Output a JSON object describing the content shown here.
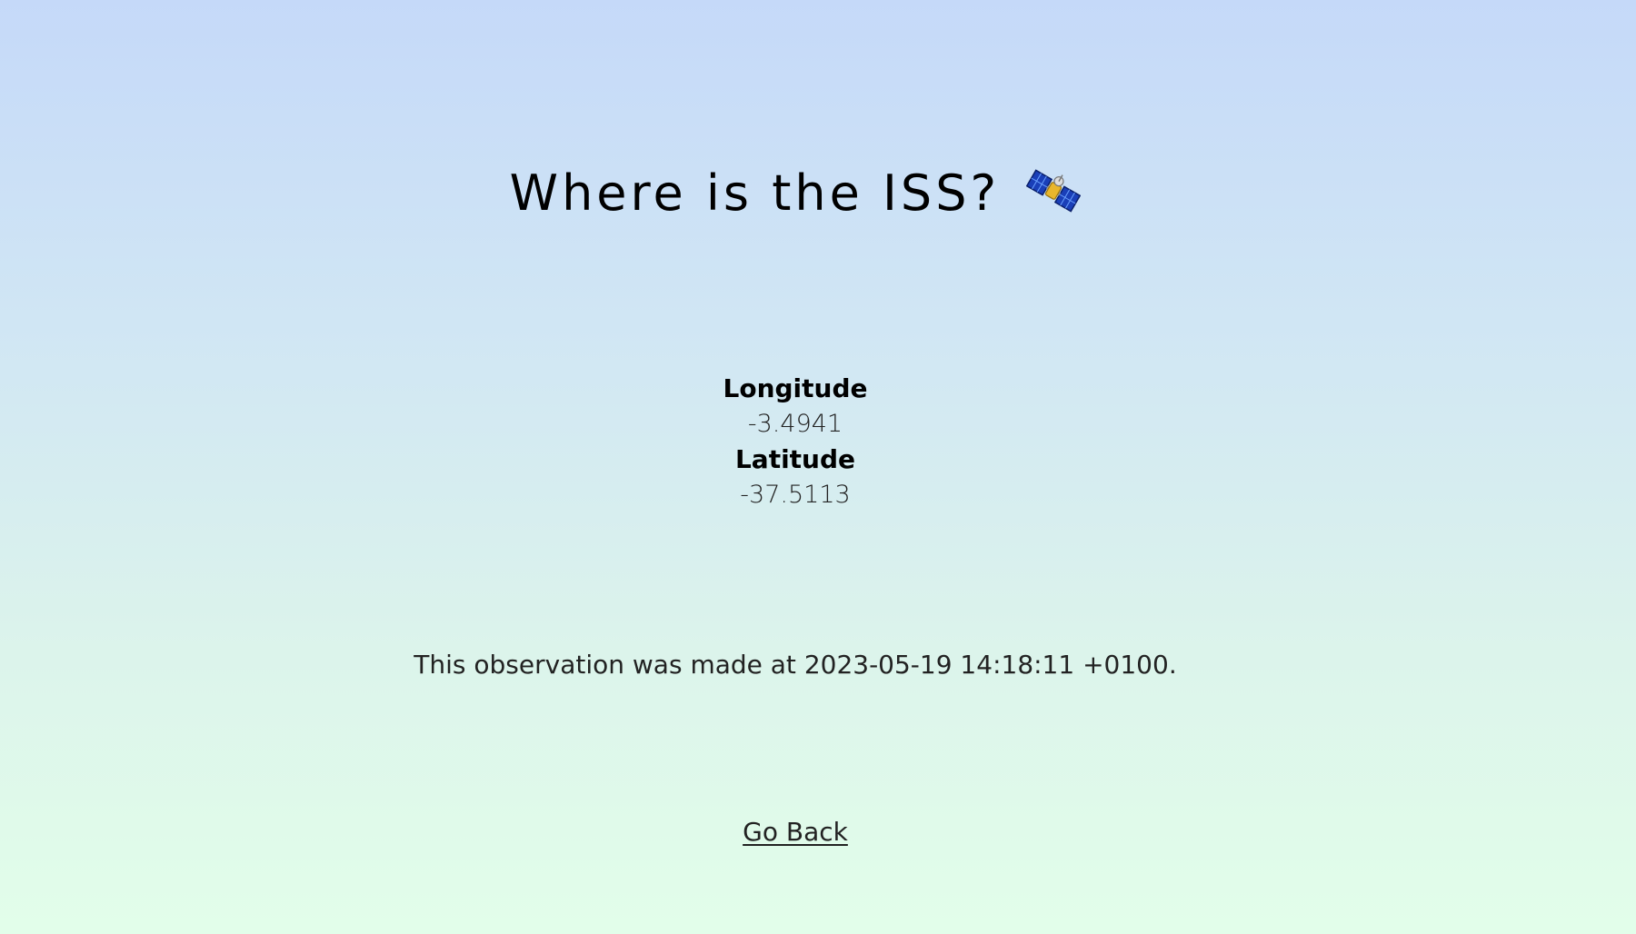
{
  "page": {
    "title": "Where is the ISS?",
    "title_icon": "satellite-icon"
  },
  "coordinates": {
    "longitude_label": "Longitude",
    "longitude_value": "-3.4941",
    "latitude_label": "Latitude",
    "latitude_value": "-37.5113"
  },
  "observation": {
    "prefix": "This observation was made at ",
    "timestamp": "2023-05-19 14:18:11 +0100",
    "suffix": "."
  },
  "navigation": {
    "go_back_label": "Go Back"
  },
  "colors": {
    "gradient_top": "#c5d9f9",
    "gradient_bottom": "#e2feea"
  }
}
